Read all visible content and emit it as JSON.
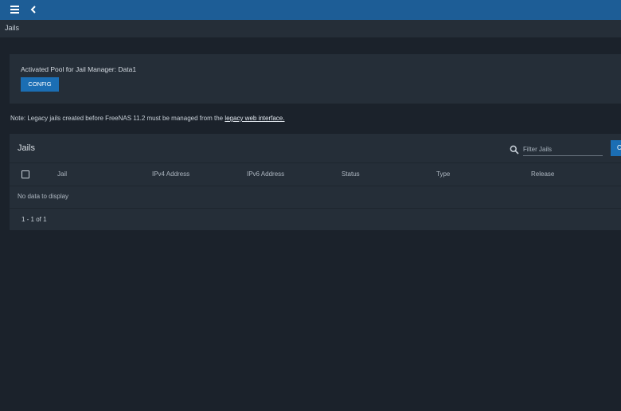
{
  "breadcrumb": "Jails",
  "pool_card": {
    "label": "Activated Pool for Jail Manager: Data1",
    "config_button": "CONFIG"
  },
  "note": {
    "prefix": "Note: Legacy jails created before FreeNAS 11.2 must be managed from the ",
    "link": "legacy web interface."
  },
  "jails_card": {
    "title": "Jails",
    "filter_placeholder": "Filter Jails",
    "add_button": "C",
    "columns": [
      "Jail",
      "IPv4 Address",
      "IPv6 Address",
      "Status",
      "Type",
      "Release"
    ],
    "empty_message": "No data to display",
    "paginator": "1 - 1 of 1"
  },
  "colors": {
    "topbar": "#1d5d96",
    "background": "#1b222b",
    "card": "#252e38",
    "accent_button": "#1b6eb4"
  }
}
